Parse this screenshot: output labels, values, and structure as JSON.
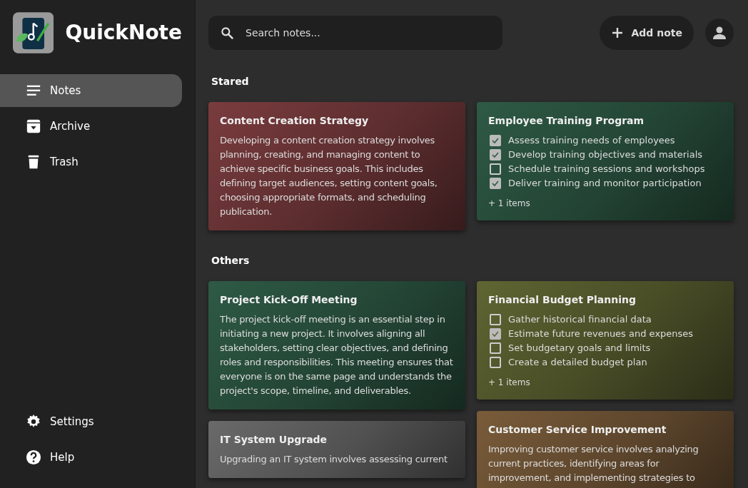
{
  "app": {
    "title": "QuickNote"
  },
  "sidebar": {
    "items": [
      {
        "label": "Notes",
        "selected": true
      },
      {
        "label": "Archive",
        "selected": false
      },
      {
        "label": "Trash",
        "selected": false
      }
    ],
    "bottom_items": [
      {
        "label": "Settings",
        "selected": false
      },
      {
        "label": "Help",
        "selected": false
      }
    ]
  },
  "search": {
    "placeholder": "Search notes..."
  },
  "add_button": {
    "label": "Add note"
  },
  "sections": [
    {
      "title": "Stared",
      "columns": [
        [
          {
            "kind": "text",
            "title": "Content Creation Strategy",
            "color": "#7a3c3e",
            "body": "Developing a content creation strategy involves planning, creating, and managing content to achieve specific business goals. This includes defining target audiences, setting content goals, choosing appropriate formats, and scheduling publication."
          }
        ],
        [
          {
            "kind": "checklist",
            "title": "Employee Training Program",
            "color": "#2e5a45",
            "items": [
              {
                "text": "Assess training needs of employees",
                "checked": true
              },
              {
                "text": "Develop training objectives and materials",
                "checked": true
              },
              {
                "text": "Schedule training sessions and workshops",
                "checked": false
              },
              {
                "text": "Deliver training and monitor participation",
                "checked": true
              }
            ],
            "more": "+ 1 items"
          }
        ]
      ]
    },
    {
      "title": "Others",
      "columns": [
        [
          {
            "kind": "text",
            "title": "Project Kick-Off Meeting",
            "color": "#2e5a45",
            "body": "The project kick-off meeting is an essential step in initiating a new project. It involves aligning all stakeholders, setting clear objectives, and defining roles and responsibilities. This meeting ensures that everyone is on the same page and understands the project's scope, timeline, and deliverables."
          },
          {
            "kind": "text",
            "title": "IT System Upgrade",
            "color": "#6a6a6a",
            "body": "Upgrading an IT system involves assessing current"
          }
        ],
        [
          {
            "kind": "checklist",
            "title": "Financial Budget Planning",
            "color": "#5f6532",
            "items": [
              {
                "text": "Gather historical financial data",
                "checked": false
              },
              {
                "text": "Estimate future revenues and expenses",
                "checked": true
              },
              {
                "text": "Set budgetary goals and limits",
                "checked": false
              },
              {
                "text": "Create a detailed budget plan",
                "checked": false
              }
            ],
            "more": "+ 1 items"
          },
          {
            "kind": "text",
            "title": "Customer Service Improvement",
            "color": "#7a5c3a",
            "body": "Improving customer service involves analyzing current practices, identifying areas for improvement, and implementing strategies to"
          }
        ]
      ]
    }
  ]
}
